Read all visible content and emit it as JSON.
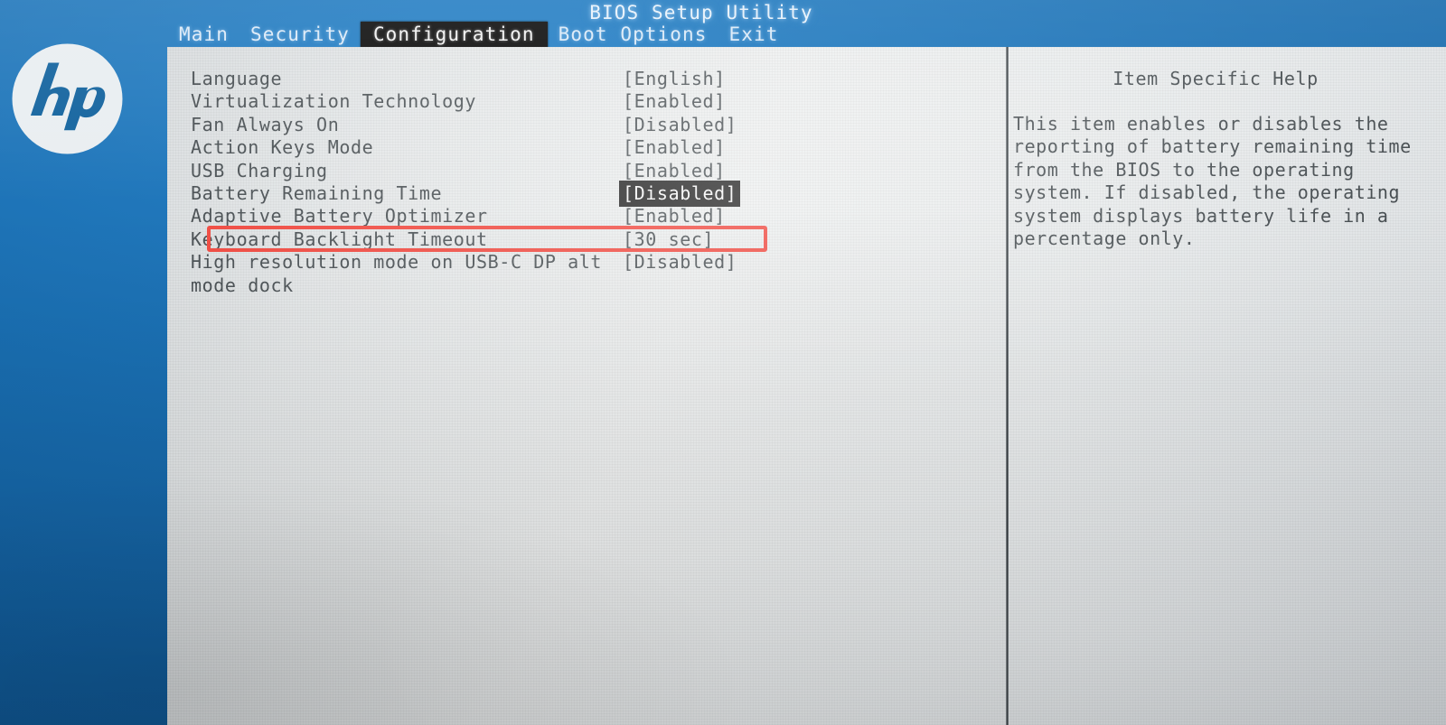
{
  "window": {
    "title": "BIOS Setup Utility",
    "vendor_logo": "hp-logo",
    "accent_blue": "#1768ad",
    "panel_gray": "#e6e9ea",
    "selection_black": "#121212",
    "annotation_red": "#ef3b31"
  },
  "menubar": {
    "items": [
      {
        "label": "Main",
        "active": false
      },
      {
        "label": "Security",
        "active": false
      },
      {
        "label": "Configuration",
        "active": true
      },
      {
        "label": "Boot Options",
        "active": false
      },
      {
        "label": "Exit",
        "active": false
      }
    ]
  },
  "settings": {
    "rows": [
      {
        "label": "Language",
        "value": "[English]",
        "selected": false,
        "annotated": false
      },
      {
        "label": "Virtualization Technology",
        "value": "[Enabled]",
        "selected": false,
        "annotated": false
      },
      {
        "label": "Fan Always On",
        "value": "[Disabled]",
        "selected": false,
        "annotated": false
      },
      {
        "label": "Action Keys Mode",
        "value": "[Enabled]",
        "selected": false,
        "annotated": false
      },
      {
        "label": "USB Charging",
        "value": "[Enabled]",
        "selected": false,
        "annotated": false
      },
      {
        "label": "Battery Remaining Time",
        "value": "[Disabled]",
        "selected": true,
        "annotated": false
      },
      {
        "label": "Adaptive Battery Optimizer",
        "value": "[Enabled]",
        "selected": false,
        "annotated": true
      },
      {
        "label": "Keyboard Backlight Timeout",
        "value": "[30 sec]",
        "selected": false,
        "annotated": false
      },
      {
        "label": "High resolution mode on USB-C DP alt",
        "value": "[Disabled]",
        "selected": false,
        "annotated": false
      },
      {
        "label": "mode dock",
        "value": "",
        "selected": false,
        "annotated": false
      }
    ]
  },
  "help": {
    "title": "Item Specific Help",
    "body": "This item enables or disables the\nreporting of battery remaining time\nfrom the BIOS to the operating\nsystem. If disabled, the operating\nsystem displays battery life in a\npercentage only."
  }
}
